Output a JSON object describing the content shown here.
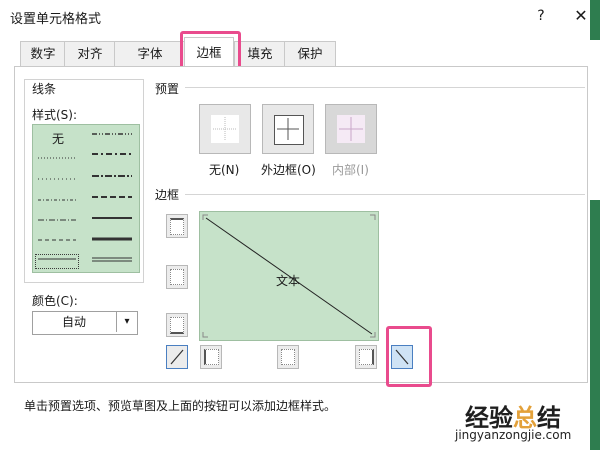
{
  "window": {
    "title": "设置单元格格式",
    "help": "?",
    "close": "✕"
  },
  "tabs": [
    {
      "label": "数字"
    },
    {
      "label": "对齐"
    },
    {
      "label": "字体"
    },
    {
      "label": "边框",
      "active": true
    },
    {
      "label": "填充"
    },
    {
      "label": "保护"
    }
  ],
  "line_group": {
    "title": "线条",
    "style_label": "样式(S):",
    "none_label": "无",
    "color_label": "颜色(C):",
    "color_value": "自动"
  },
  "presets": {
    "title": "预置",
    "items": [
      {
        "label": "无(N)",
        "enabled": true
      },
      {
        "label": "外边框(O)",
        "enabled": true
      },
      {
        "label": "内部(I)",
        "enabled": false
      }
    ]
  },
  "border": {
    "title": "边框",
    "preview_text": "文本"
  },
  "hint": "单击预置选项、预览草图及上面的按钮可以添加边框样式。",
  "watermark": {
    "brand_a": "经验",
    "brand_b": "总",
    "brand_c": "结",
    "url": "jingyanzongjie.com"
  },
  "colors": {
    "highlight": "#e94b8d",
    "preview_bg": "#c6e2c9",
    "green_strip": "#2e7d4f"
  }
}
